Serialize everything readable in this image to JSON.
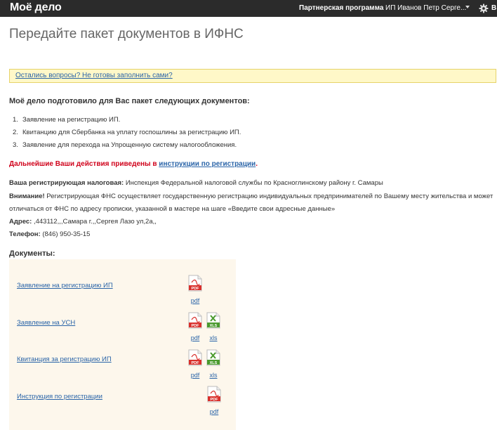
{
  "topbar": {
    "logo": "Моё дело",
    "partner": "Партнерская программа",
    "user": "ИП Иванов Петр Серге...",
    "exit_label": "В"
  },
  "page_title": "Передайте пакет документов в ИФНС",
  "notice_link": "Остались вопросы? Не готовы заполнить сами?",
  "intro": "Моё дело подготовило для Вас пакет следующих документов:",
  "documents_list": [
    {
      "num": "1.",
      "text": "Заявление на регистрацию ИП."
    },
    {
      "num": "2.",
      "text": "Квитанцию для Сбербанка на уплату госпошлины за регистрацию ИП."
    },
    {
      "num": "3.",
      "text": "Заявление для перехода на Упрощенную систему налогообложения."
    }
  ],
  "actions": {
    "text": "Дальнейшие Ваши действия приведены в ",
    "link": "инструкции по регистрации",
    "dot": "."
  },
  "info": {
    "tax_label": "Ваша регистрирующая налоговая:",
    "tax_value": " Инспекция Федеральной налоговой службы по Красноглинскому району г. Самары",
    "warning_label": "Внимание!",
    "warning_text": " Регистрирующая ФНС осуществляет государственную регистрацию индивидуальных предпринимателей по Вашему месту жительства и может",
    "warning_text2": "отличаться от ФНС по адресу прописки, указанной в мастере на шаге «Введите свои адресные данные»",
    "address_label": "Адрес:",
    "address_value": " ,443112,,,Самара г.,,Сергея Лазо ул,2а,,",
    "phone_label": "Телефон:",
    "phone_value": " (846) 950-35-15"
  },
  "docs_title": "Документы:",
  "docs": [
    {
      "name": "Заявление на регистрацию ИП",
      "files": [
        "pdf"
      ]
    },
    {
      "name": "Заявление на УСН",
      "files": [
        "pdf",
        "xls"
      ]
    },
    {
      "name": "Квитанция за регистрацию ИП",
      "files": [
        "pdf",
        "xls"
      ]
    },
    {
      "name": "Инструкция по регистрации",
      "files": [
        "pdf"
      ]
    }
  ],
  "file_labels": {
    "pdf": "PDF",
    "xls": "XLS"
  },
  "colors": {
    "pdf": "#d9302c",
    "xls": "#4a9a2e",
    "accent": "#2a64a8",
    "warning": "#d0021b"
  },
  "icons": {
    "settings": "gear-icon",
    "user_menu": "chevron-down-icon",
    "pdf": "pdf-file-icon",
    "xls": "xls-file-icon"
  }
}
